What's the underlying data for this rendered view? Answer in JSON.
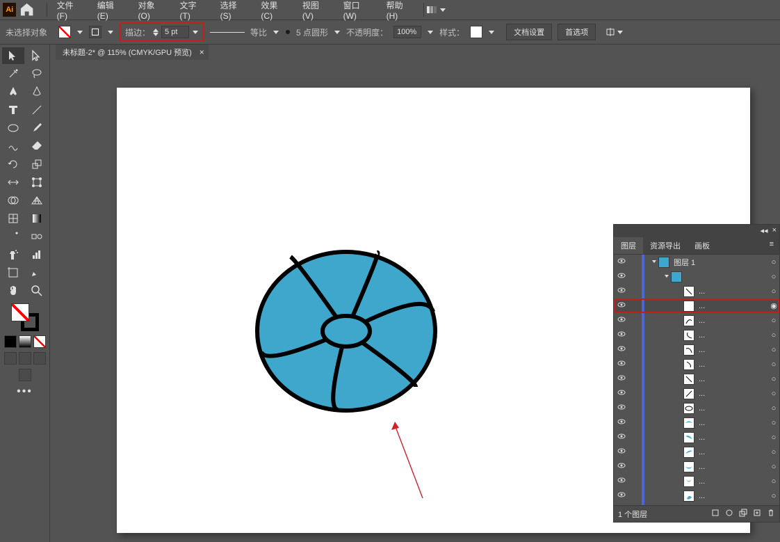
{
  "menu": {
    "file": "文件(F)",
    "edit": "编辑(E)",
    "object": "对象(O)",
    "type": "文字(T)",
    "select": "选择(S)",
    "effect": "效果(C)",
    "view": "视图(V)",
    "window": "窗口(W)",
    "help": "帮助(H)"
  },
  "control": {
    "no_selection": "未选择对象",
    "stroke_label": "描边：",
    "stroke_value": "5 pt",
    "profile_label": "等比",
    "brush_label": "5 点圆形",
    "opacity_label": "不透明度：",
    "opacity_value": "100%",
    "style_label": "样式：",
    "doc_setup": "文档设置",
    "preferences": "首选项"
  },
  "document": {
    "tab_title": "未标题-2* @ 115% (CMYK/GPU 预览)"
  },
  "layers_panel": {
    "tab_layers": "图层",
    "tab_assets": "资源导出",
    "tab_artboards": "画板",
    "root_name": "图层 1",
    "footer": "1 个图层",
    "items": [
      {
        "name": "...",
        "type": "line-lr"
      },
      {
        "name": "...",
        "type": "white",
        "hl": true
      },
      {
        "name": "...",
        "type": "curve1"
      },
      {
        "name": "...",
        "type": "curve2"
      },
      {
        "name": "...",
        "type": "curve3"
      },
      {
        "name": "...",
        "type": "curve4"
      },
      {
        "name": "...",
        "type": "curve5"
      },
      {
        "name": "...",
        "type": "curve6"
      },
      {
        "name": "...",
        "type": "ellipse"
      },
      {
        "name": "...",
        "type": "wedge1"
      },
      {
        "name": "...",
        "type": "wedge2"
      },
      {
        "name": "...",
        "type": "wedge3"
      },
      {
        "name": "...",
        "type": "wedge4"
      },
      {
        "name": "...",
        "type": "wedge5"
      },
      {
        "name": "...",
        "type": "wedge6"
      },
      {
        "name": "...",
        "type": "wedge7"
      }
    ]
  }
}
